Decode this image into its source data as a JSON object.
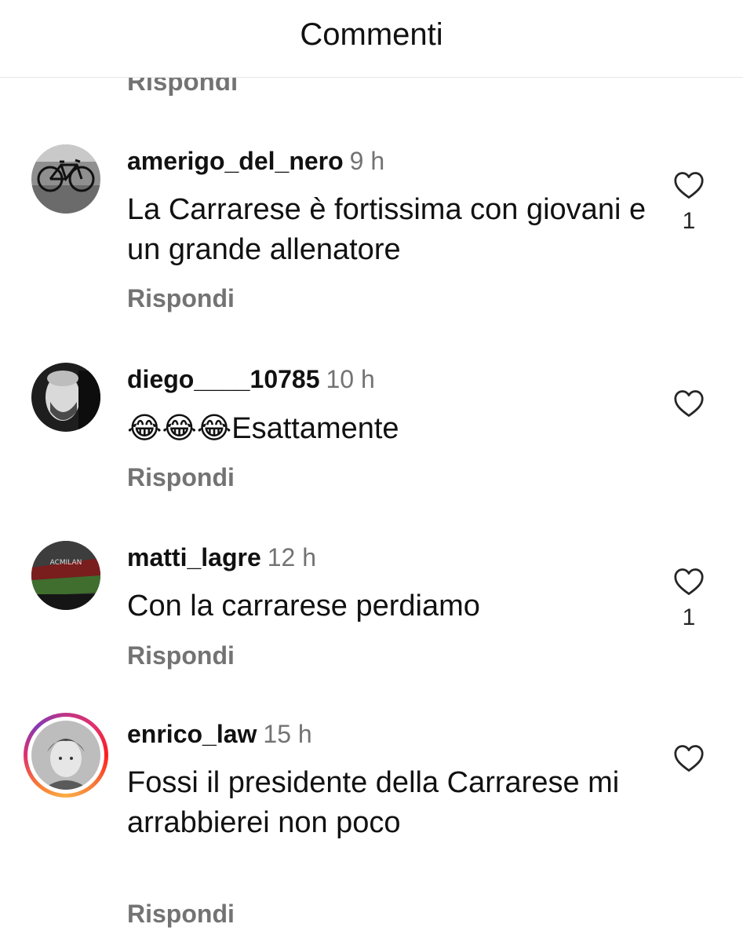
{
  "header": {
    "title": "Commenti"
  },
  "previous_reply_label": "Rispondi",
  "comments": [
    {
      "username": "amerigo_del_nero",
      "time": "9 h",
      "text": "La Carrarese è fortissima con giovani e un grande allenatore",
      "reply_label": "Rispondi",
      "like_count": "1",
      "avatar_icon": "bicycle-avatar"
    },
    {
      "username": "diego____10785",
      "time": "10 h",
      "emoji": "😂😂😂",
      "text": "Esattamente",
      "reply_label": "Rispondi",
      "like_count": "",
      "avatar_icon": "man-profile-avatar"
    },
    {
      "username": "matti_lagre",
      "time": "12 h",
      "text": "Con la carrarese perdiamo",
      "reply_label": "Rispondi",
      "like_count": "1",
      "avatar_icon": "stadium-avatar"
    },
    {
      "username": "enrico_law",
      "time": "15 h",
      "text": "Fossi il presidente della Carrarese mi arrabbierei non poco",
      "reply_label": "Rispondi",
      "like_count": "",
      "avatar_icon": "person-photo-avatar",
      "story_ring": true
    }
  ],
  "colors": {
    "secondary_text": "#737373",
    "primary_text": "#111111",
    "heart_outline": "#262626"
  }
}
